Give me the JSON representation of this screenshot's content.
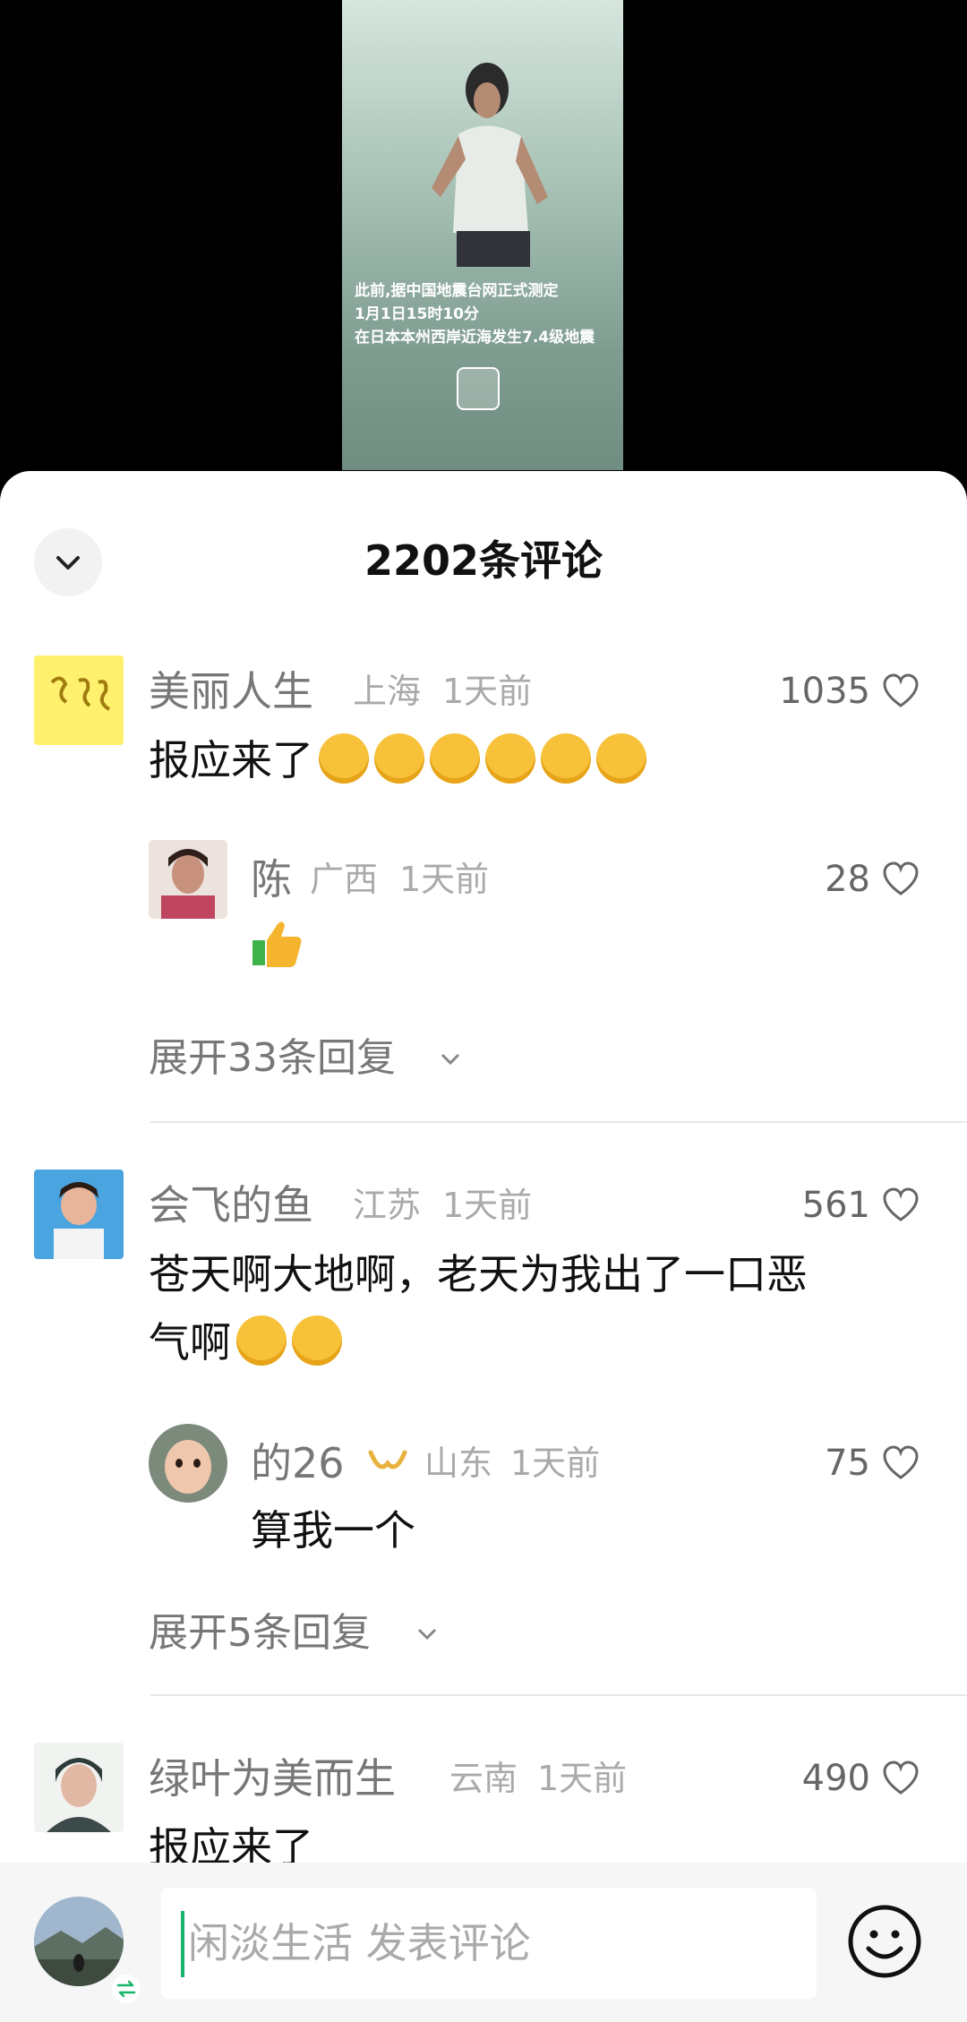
{
  "video": {
    "caption_lines": [
      "此前,据中国地震台网正式测定",
      "1月1日15时10分",
      "在日本本州西岸近海发生7.4级地震"
    ]
  },
  "sheet": {
    "title": "2202条评论"
  },
  "comments": [
    {
      "name": "美丽人生",
      "location": "上海",
      "time": "1天前",
      "likes": "1035",
      "text": "报应来了",
      "emoji_count": 6,
      "reply": {
        "name": "陈",
        "location": "广西",
        "time": "1天前",
        "likes": "28",
        "text": ""
      },
      "expand": "展开33条回复"
    },
    {
      "name": "会飞的鱼",
      "location": "江苏",
      "time": "1天前",
      "likes": "561",
      "text_line1": "苍天啊大地啊，老天为我出了一口恶",
      "text_line2": "气啊",
      "emoji_count": 2,
      "reply": {
        "name": "的26",
        "location": "山东",
        "time": "1天前",
        "likes": "75",
        "text": "算我一个"
      },
      "expand": "展开5条回复"
    },
    {
      "name": "绿叶为美而生",
      "location": "云南",
      "time": "1天前",
      "likes": "490",
      "text": "报应来了"
    }
  ],
  "composer": {
    "placeholder": "闲淡生活 发表评论"
  },
  "colors": {
    "accent": "#19b36b",
    "emoji": "#f7c23a"
  }
}
